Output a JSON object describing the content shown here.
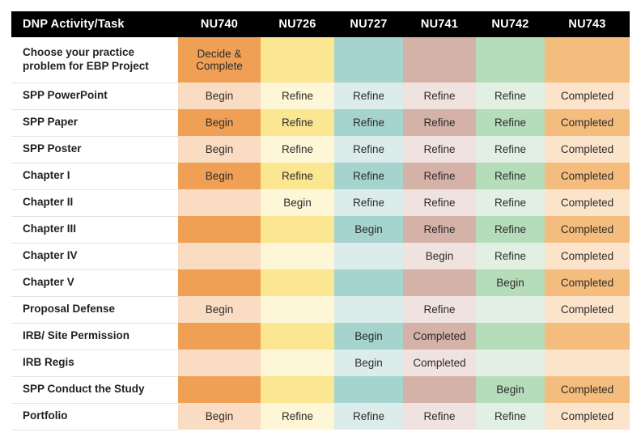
{
  "table": {
    "headers": [
      "DNP Activity/Task",
      "NU740",
      "NU726",
      "NU727",
      "NU741",
      "NU742",
      "NU743"
    ],
    "column_keys": [
      "label",
      "NU740",
      "NU726",
      "NU727",
      "NU741",
      "NU742",
      "NU743"
    ],
    "palette": {
      "header_bg": "#000000",
      "header_fg": "#ffffff",
      "label_bg": "#ffffff",
      "label_fg": "#231f20",
      "cell_fg": "#2b2b2b",
      "row_divider": "#e3e3e3",
      "NU740_strong": "#f0a055",
      "NU740_light": "#fadcc2",
      "NU726_strong": "#fbe791",
      "NU726_light": "#fdf7d7",
      "NU727_strong": "#a5d3cd",
      "NU727_light": "#dceceb",
      "NU741_strong": "#d5b2a8",
      "NU741_light": "#f0e3df",
      "NU742_strong": "#b6ddb9",
      "NU742_light": "#e2f0e3",
      "NU743_strong": "#f5bd7d",
      "NU743_light": "#fce4cb"
    },
    "rows": [
      {
        "label": "Choose your practice problem for EBP Project",
        "tall": true,
        "cells": [
          {
            "text": "Decide & Complete",
            "shade": "strong"
          },
          {
            "text": "",
            "shade": "strong"
          },
          {
            "text": "",
            "shade": "strong"
          },
          {
            "text": "",
            "shade": "strong"
          },
          {
            "text": "",
            "shade": "strong"
          },
          {
            "text": "",
            "shade": "strong"
          }
        ]
      },
      {
        "label": "SPP PowerPoint",
        "tall": false,
        "cells": [
          {
            "text": "Begin",
            "shade": "light"
          },
          {
            "text": "Refine",
            "shade": "light"
          },
          {
            "text": "Refine",
            "shade": "light"
          },
          {
            "text": "Refine",
            "shade": "light"
          },
          {
            "text": "Refine",
            "shade": "light"
          },
          {
            "text": "Completed",
            "shade": "light"
          }
        ]
      },
      {
        "label": "SPP Paper",
        "tall": false,
        "cells": [
          {
            "text": "Begin",
            "shade": "strong"
          },
          {
            "text": "Refine",
            "shade": "strong"
          },
          {
            "text": "Refine",
            "shade": "strong"
          },
          {
            "text": "Refine",
            "shade": "strong"
          },
          {
            "text": "Refine",
            "shade": "strong"
          },
          {
            "text": "Completed",
            "shade": "strong"
          }
        ]
      },
      {
        "label": "SPP Poster",
        "tall": false,
        "cells": [
          {
            "text": "Begin",
            "shade": "light"
          },
          {
            "text": "Refine",
            "shade": "light"
          },
          {
            "text": "Refine",
            "shade": "light"
          },
          {
            "text": "Refine",
            "shade": "light"
          },
          {
            "text": "Refine",
            "shade": "light"
          },
          {
            "text": "Completed",
            "shade": "light"
          }
        ]
      },
      {
        "label": "Chapter I",
        "tall": false,
        "cells": [
          {
            "text": "Begin",
            "shade": "strong"
          },
          {
            "text": "Refine",
            "shade": "strong"
          },
          {
            "text": "Refine",
            "shade": "strong"
          },
          {
            "text": "Refine",
            "shade": "strong"
          },
          {
            "text": "Refine",
            "shade": "strong"
          },
          {
            "text": "Completed",
            "shade": "strong"
          }
        ]
      },
      {
        "label": "Chapter II",
        "tall": false,
        "cells": [
          {
            "text": "",
            "shade": "light"
          },
          {
            "text": "Begin",
            "shade": "light"
          },
          {
            "text": "Refine",
            "shade": "light"
          },
          {
            "text": "Refine",
            "shade": "light"
          },
          {
            "text": "Refine",
            "shade": "light"
          },
          {
            "text": "Completed",
            "shade": "light"
          }
        ]
      },
      {
        "label": "Chapter III",
        "tall": false,
        "cells": [
          {
            "text": "",
            "shade": "strong"
          },
          {
            "text": "",
            "shade": "strong"
          },
          {
            "text": "Begin",
            "shade": "strong"
          },
          {
            "text": "Refine",
            "shade": "strong"
          },
          {
            "text": "Refine",
            "shade": "strong"
          },
          {
            "text": "Completed",
            "shade": "strong"
          }
        ]
      },
      {
        "label": "Chapter IV",
        "tall": false,
        "cells": [
          {
            "text": "",
            "shade": "light"
          },
          {
            "text": "",
            "shade": "light"
          },
          {
            "text": "",
            "shade": "light"
          },
          {
            "text": "Begin",
            "shade": "light"
          },
          {
            "text": "Refine",
            "shade": "light"
          },
          {
            "text": "Completed",
            "shade": "light"
          }
        ]
      },
      {
        "label": "Chapter V",
        "tall": false,
        "cells": [
          {
            "text": "",
            "shade": "strong"
          },
          {
            "text": "",
            "shade": "strong"
          },
          {
            "text": "",
            "shade": "strong"
          },
          {
            "text": "",
            "shade": "strong"
          },
          {
            "text": "Begin",
            "shade": "strong"
          },
          {
            "text": "Completed",
            "shade": "strong"
          }
        ]
      },
      {
        "label": "Proposal Defense",
        "tall": false,
        "cells": [
          {
            "text": "Begin",
            "shade": "light"
          },
          {
            "text": "",
            "shade": "light"
          },
          {
            "text": "",
            "shade": "light"
          },
          {
            "text": "Refine",
            "shade": "light"
          },
          {
            "text": "",
            "shade": "light"
          },
          {
            "text": "Completed",
            "shade": "light"
          }
        ]
      },
      {
        "label": "IRB/ Site Permission",
        "tall": false,
        "cells": [
          {
            "text": "",
            "shade": "strong"
          },
          {
            "text": "",
            "shade": "strong"
          },
          {
            "text": "Begin",
            "shade": "strong"
          },
          {
            "text": "Completed",
            "shade": "strong"
          },
          {
            "text": "",
            "shade": "strong"
          },
          {
            "text": "",
            "shade": "strong"
          }
        ]
      },
      {
        "label": "IRB Regis",
        "tall": false,
        "cells": [
          {
            "text": "",
            "shade": "light"
          },
          {
            "text": "",
            "shade": "light"
          },
          {
            "text": "Begin",
            "shade": "light"
          },
          {
            "text": "Completed",
            "shade": "light"
          },
          {
            "text": "",
            "shade": "light"
          },
          {
            "text": "",
            "shade": "light"
          }
        ]
      },
      {
        "label": "SPP Conduct the Study",
        "tall": false,
        "cells": [
          {
            "text": "",
            "shade": "strong"
          },
          {
            "text": "",
            "shade": "strong"
          },
          {
            "text": "",
            "shade": "strong"
          },
          {
            "text": "",
            "shade": "strong"
          },
          {
            "text": "Begin",
            "shade": "strong"
          },
          {
            "text": "Completed",
            "shade": "strong"
          }
        ]
      },
      {
        "label": "Portfolio",
        "tall": false,
        "cells": [
          {
            "text": "Begin",
            "shade": "light"
          },
          {
            "text": "Refine",
            "shade": "light"
          },
          {
            "text": "Refine",
            "shade": "light"
          },
          {
            "text": "Refine",
            "shade": "light"
          },
          {
            "text": "Refine",
            "shade": "light"
          },
          {
            "text": "Completed",
            "shade": "light"
          }
        ]
      }
    ]
  }
}
